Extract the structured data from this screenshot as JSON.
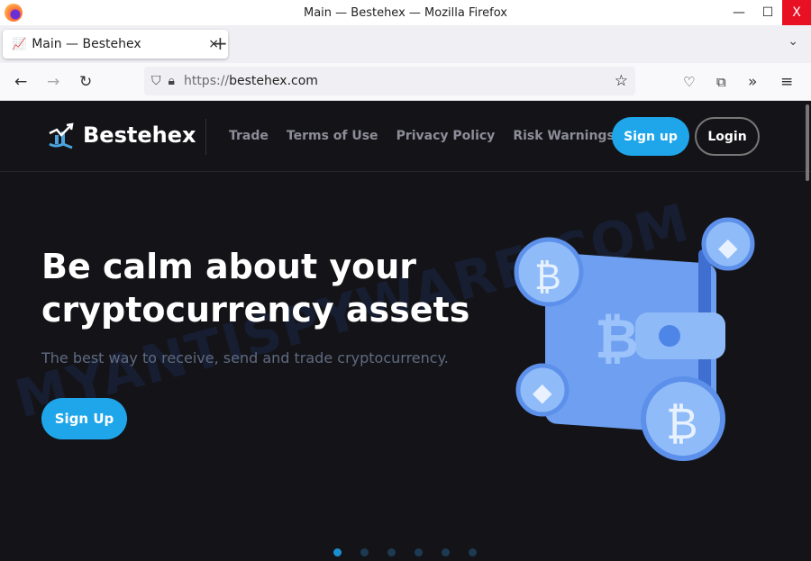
{
  "window": {
    "title": "Main — Bestehex — Mozilla Firefox",
    "minimize": "—",
    "maximize": "☐",
    "close": "X"
  },
  "tab": {
    "label": "Main — Bestehex",
    "close": "×",
    "new": "+",
    "list": "⌄"
  },
  "toolbar": {
    "back": "←",
    "forward": "→",
    "reload": "↻",
    "url_proto": "https://",
    "url_host": "bestehex.com",
    "bookmark": "☆",
    "pocket": "♡",
    "extensions": "⧉",
    "more": "»",
    "menu": "≡"
  },
  "site": {
    "brand": "Bestehex",
    "nav": [
      "Trade",
      "Terms of Use",
      "Privacy Policy",
      "Risk Warnings"
    ],
    "signup": "Sign up",
    "login": "Login",
    "hero_title": "Be calm about your cryptocurrency assets",
    "hero_sub": "The best way to receive, send and trade cryptocurrency.",
    "hero_button": "Sign Up",
    "slides": 6,
    "active_slide": 1,
    "accent": "#1fa6ea"
  },
  "watermark": "MYANTISPYWARE.COM"
}
